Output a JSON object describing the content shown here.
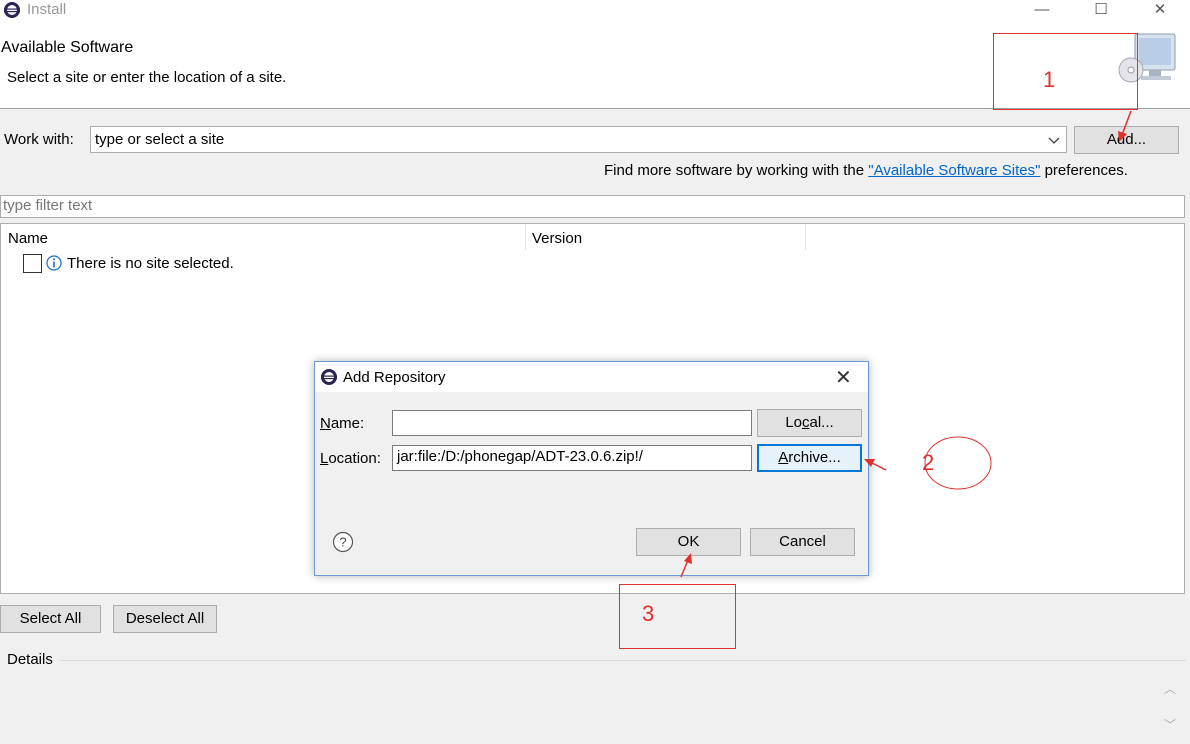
{
  "window": {
    "title": "Install",
    "controls": {
      "minimize": "—",
      "maximize": "☐",
      "close": "✕"
    }
  },
  "header": {
    "title": "Available Software",
    "subtitle": "Select a site or enter the location of a site."
  },
  "work_with": {
    "label": "Work with:",
    "value": "type or select a site",
    "add_label": "Add..."
  },
  "find_more": {
    "prefix": "Find more software by working with the",
    "link": "\"Available Software Sites\"",
    "suffix": "preferences."
  },
  "filter": {
    "placeholder": "type filter text"
  },
  "table": {
    "columns": [
      "Name",
      "Version"
    ],
    "rows": [
      {
        "text": "There is no site selected.",
        "icon": "info-icon",
        "checked": false
      }
    ]
  },
  "buttons": {
    "select_all": "Select All",
    "deselect_all": "Deselect All"
  },
  "details": {
    "label": "Details"
  },
  "dialog": {
    "title": "Add Repository",
    "name_label_u": "N",
    "name_label_rest": "ame:",
    "name_value": "",
    "location_label_u": "L",
    "location_label_rest": "ocation:",
    "location_value": "jar:file:/D:/phonegap/ADT-23.0.6.zip!/",
    "local_pre": "Lo",
    "local_u": "c",
    "local_post": "al...",
    "archive_u": "A",
    "archive_rest": "rchive...",
    "ok_label": "OK",
    "cancel_label": "Cancel",
    "close": "✕"
  },
  "annotations": [
    "1",
    "2",
    "3"
  ],
  "colors": {
    "annotation": "#e03030",
    "link": "#0066cc",
    "focus": "#0078d7"
  }
}
